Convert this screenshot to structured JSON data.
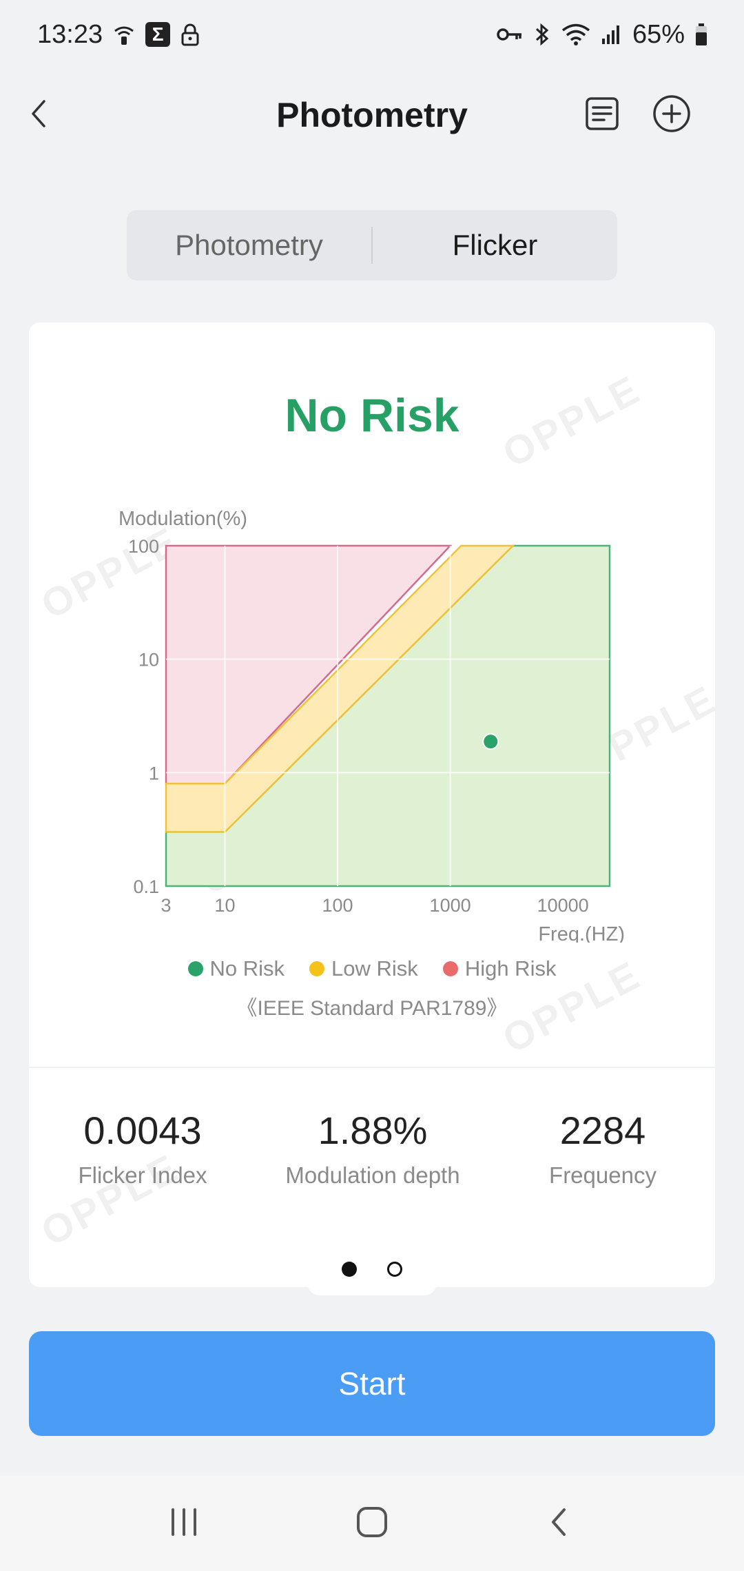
{
  "status": {
    "time": "13:23",
    "battery": "65%",
    "icons": [
      "wifi-calling-icon",
      "sigma-icon",
      "lock-icon",
      "key-icon",
      "bluetooth-icon",
      "wifi-icon",
      "signal-icon",
      "battery-icon"
    ]
  },
  "appbar": {
    "title": "Photometry",
    "icons": [
      "back-icon",
      "list-icon",
      "add-circle-icon"
    ]
  },
  "tabs": [
    {
      "label": "Photometry",
      "active": false
    },
    {
      "label": "Flicker",
      "active": true
    }
  ],
  "result": {
    "risk_label": "No Risk",
    "risk_color": "#27a065",
    "watermark": "OPPLE"
  },
  "legend": [
    {
      "label": "No Risk",
      "color": "#2aa36a"
    },
    {
      "label": "Low Risk",
      "color": "#f5c21b"
    },
    {
      "label": "High Risk",
      "color": "#ea6b6b"
    }
  ],
  "standard_note": "《IEEE Standard PAR1789》",
  "metrics": [
    {
      "value": "0.0043",
      "label": "Flicker Index"
    },
    {
      "value": "1.88%",
      "label": "Modulation depth"
    },
    {
      "value": "2284",
      "label": "Frequency"
    }
  ],
  "pager": {
    "count": 2,
    "current": 1
  },
  "start_button": "Start",
  "chart_data": {
    "type": "area",
    "xlabel": "Freq.(HZ)",
    "ylabel": "Modulation(%)",
    "x_scale": "log",
    "y_scale": "log",
    "x_ticks": [
      "3",
      "10",
      "100",
      "1000",
      "10000"
    ],
    "y_ticks": [
      "100",
      "10",
      "1",
      "0.1"
    ],
    "xlim": [
      3,
      26000
    ],
    "ylim": [
      0.1,
      100
    ],
    "grid": true,
    "regions": [
      {
        "name": "No Risk",
        "color": "#2aa36a",
        "fill": "#dff0d3",
        "stroke": "#4cb37a",
        "boundary": [
          [
            3,
            0.3
          ],
          [
            10,
            0.3
          ],
          [
            3600,
            100
          ]
        ]
      },
      {
        "name": "Low Risk",
        "color": "#f5c21b",
        "fill": "#fdeab5",
        "stroke": "#f0c23a",
        "boundary": [
          [
            3,
            0.8
          ],
          [
            10,
            0.8
          ],
          [
            1250,
            100
          ]
        ]
      },
      {
        "name": "High Risk",
        "color": "#ea6b6b",
        "fill": "#f9e0e7",
        "stroke": "#d46a8e",
        "boundary": [
          [
            3,
            100
          ],
          [
            1000,
            100
          ]
        ]
      }
    ],
    "measurement": {
      "x": 2284,
      "y": 1.88,
      "color": "#2aa36a"
    }
  }
}
